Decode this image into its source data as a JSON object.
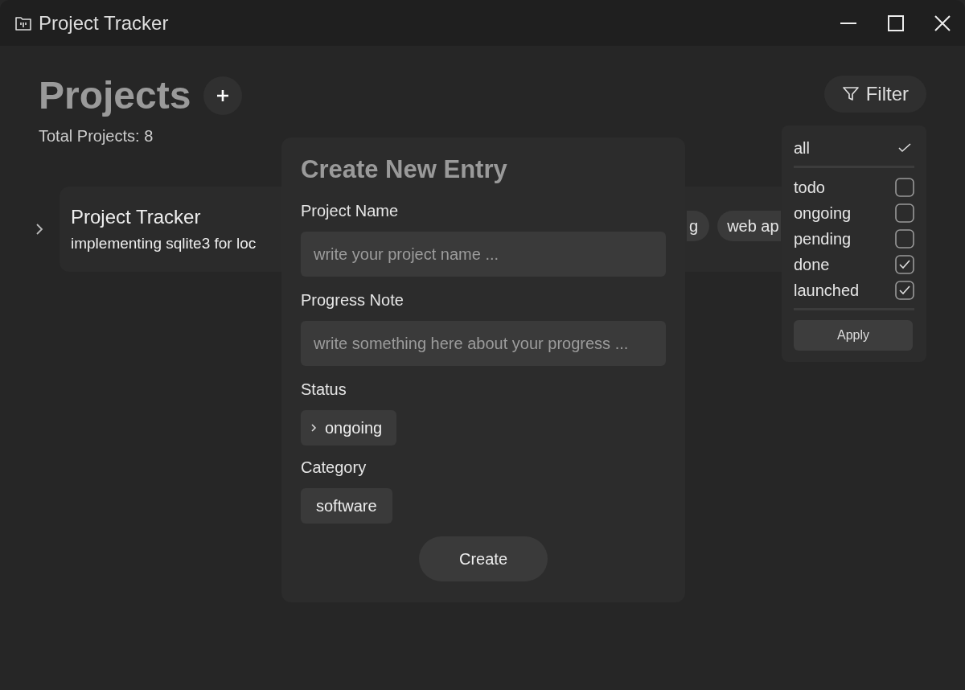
{
  "window": {
    "title": "Project Tracker"
  },
  "header": {
    "title": "Projects",
    "subtitle": "Total Projects: 8"
  },
  "filter_button": {
    "label": "Filter"
  },
  "project": {
    "title": "Project Tracker",
    "note": "implementing sqlite3 for loc",
    "expanded": false,
    "tags": [
      "g",
      "web ap"
    ]
  },
  "filter_menu": {
    "all": {
      "label": "all",
      "checked": true
    },
    "options": [
      {
        "label": "todo",
        "checked": false
      },
      {
        "label": "ongoing",
        "checked": false
      },
      {
        "label": "pending",
        "checked": false
      },
      {
        "label": "done",
        "checked": true
      },
      {
        "label": "launched",
        "checked": true
      }
    ],
    "apply": "Apply"
  },
  "dialog": {
    "title": "Create New Entry",
    "fields": [
      {
        "label": "Project Name",
        "placeholder": "write your project name ..."
      },
      {
        "label": "Progress Note",
        "placeholder": "write something here about your progress ..."
      }
    ],
    "status": {
      "label": "Status",
      "value": "ongoing",
      "expanded": false
    },
    "category": {
      "label": "Category",
      "value": "software"
    },
    "submit": "Create"
  }
}
